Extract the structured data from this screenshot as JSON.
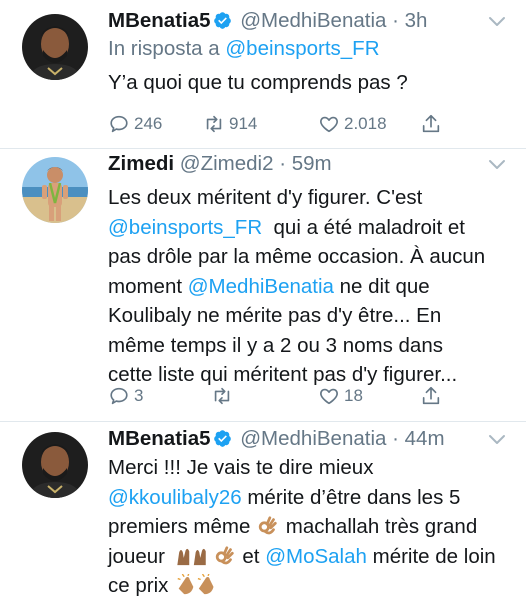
{
  "colors": {
    "accent": "#1da1f2",
    "muted": "#657786",
    "text": "#14171a",
    "divider": "#e1e8ed"
  },
  "tweets": [
    {
      "name": "MBenatia5",
      "verified": true,
      "handle": "@MedhiBenatia",
      "dot": "·",
      "time": "3h",
      "reply_prefix": "In risposta a",
      "reply_to": "@beinsports_FR",
      "text": "Y’a quoi que tu comprends pas ?",
      "replies": "246",
      "retweets": "914",
      "likes": "2.018"
    },
    {
      "name": "Zimedi",
      "handle": "@Zimedi2",
      "dot": "·",
      "time": "59m",
      "lines": [
        "Les deux méritent d'y figurer. C'est",
        {
          "mention": "@beinsports_FR",
          "rest": "  qui a été maladroit et"
        },
        "pas drôle par la même occasion. À aucun",
        {
          "pre": "moment ",
          "mention": "@MedhiBenatia",
          "rest": " ne dit que"
        },
        "Koulibaly ne mérite pas d'y être... En",
        "même temps il y a 2 ou 3 noms dans",
        "cette liste qui méritent pas d'y figurer..."
      ],
      "replies": "3",
      "retweets": "",
      "likes": "18"
    },
    {
      "name": "MBenatia5",
      "verified": true,
      "handle": "@MedhiBenatia",
      "dot": "·",
      "time": "44m",
      "lines": [
        "Merci !!! Je vais te dire mieux",
        {
          "mention": "@kkoulibaly26",
          "rest": " mérite d’être dans les 5"
        },
        {
          "pre": "premiers même ",
          "emoji_ok": "ok-hand-emoji",
          "rest": " machallah très grand"
        },
        {
          "pre": "joueur ",
          "emoji_pray": "folded-hands-emoji",
          "emoji_ok": "ok-hand-emoji",
          "mid": " et ",
          "mention": "@MoSalah",
          "rest": " mérite de loin"
        },
        {
          "pre": "ce prix ",
          "emoji_clap": "clapping-hands-emoji"
        }
      ]
    }
  ],
  "icons": {
    "reply": "reply-icon",
    "retweet": "retweet-icon",
    "like": "heart-icon",
    "share": "share-icon",
    "menu": "chevron-down-icon",
    "verified": "verified-badge-icon"
  }
}
